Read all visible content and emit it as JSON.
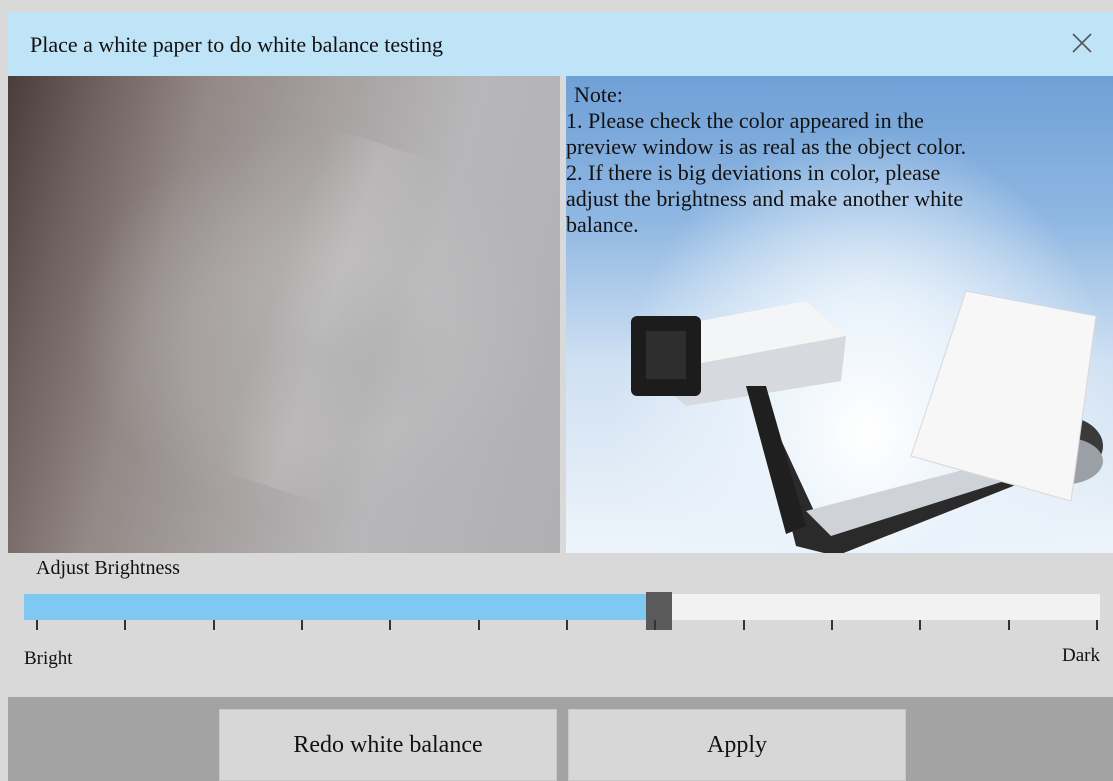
{
  "dialog": {
    "title": "Place a white paper to do white balance testing",
    "close_icon": "close-icon"
  },
  "preview": {
    "description_icon": "camera-preview"
  },
  "note": {
    "heading": "Note:",
    "line1": " 1. Please check the color appeared in the",
    "line2": "preview window is as real as the object color.",
    "line3": " 2. If there is big deviations in color, please",
    "line4": "adjust the brightness and make another white",
    "line5": "balance.",
    "illustration_icon": "scanner-device-illustration"
  },
  "brightness": {
    "label": "Adjust Brightness",
    "min_label": "Bright",
    "max_label": "Dark",
    "tick_count": 13,
    "value": 0.58,
    "fill_color": "#7ec8f1",
    "track_color": "#f2f2f2",
    "thumb_color": "#5a5a5a"
  },
  "buttons": {
    "redo_label": "Redo white balance",
    "apply_label": "Apply"
  }
}
